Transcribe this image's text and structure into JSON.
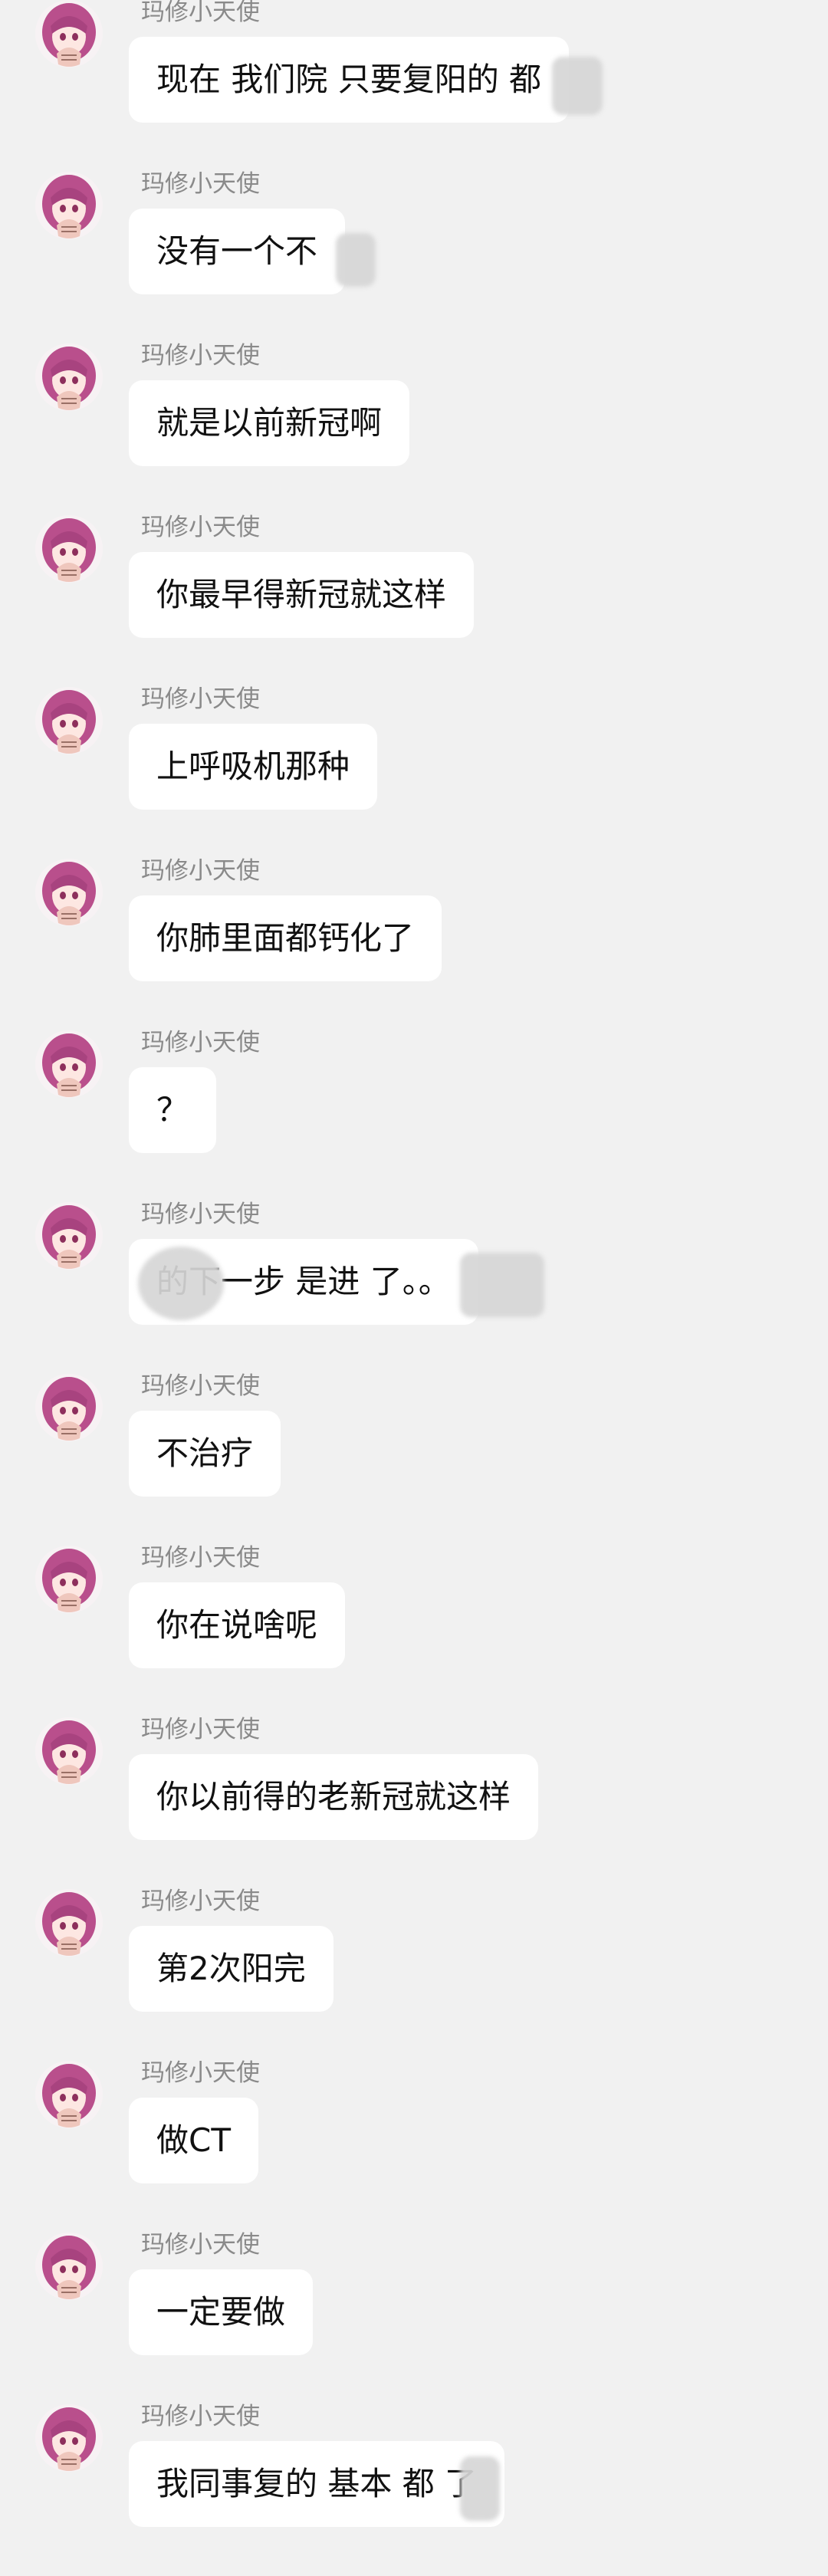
{
  "sender_name": "玛修小天使",
  "messages": [
    {
      "text": "现在 我们院 只要复阳的 都"
    },
    {
      "text": "没有一个不"
    },
    {
      "text": "就是以前新冠啊"
    },
    {
      "text": "你最早得新冠就这样"
    },
    {
      "text": "上呼吸机那种"
    },
    {
      "text": "你肺里面都钙化了"
    },
    {
      "text": "？"
    },
    {
      "text": "的下一步 是进 了。。"
    },
    {
      "text": "不治疗"
    },
    {
      "text": "你在说啥呢"
    },
    {
      "text": "你以前得的老新冠就这样"
    },
    {
      "text": "第2次阳完"
    },
    {
      "text": "做CT"
    },
    {
      "text": "一定要做"
    },
    {
      "text": "我同事复的 基本 都 了"
    }
  ],
  "colors": {
    "background": "#f1f1f1",
    "bubble": "#ffffff",
    "sender_text": "#8a8a8a",
    "message_text": "#111111",
    "avatar_hair": "#b94f8c"
  },
  "icons": {
    "avatar": "anime-avatar-icon"
  }
}
